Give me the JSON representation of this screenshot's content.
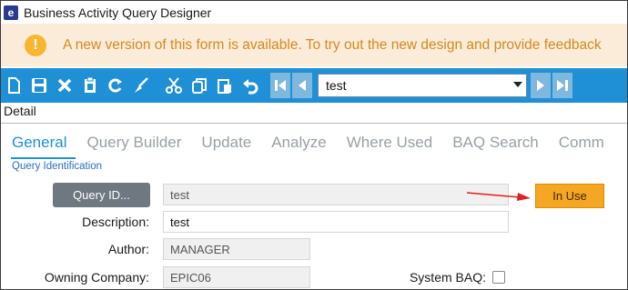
{
  "window": {
    "app_icon": "e",
    "title": "Business Activity Query Designer"
  },
  "banner": {
    "icon_text": "!",
    "message": "A new version of this form is available. To try out the new design and provide feedback"
  },
  "toolbar": {
    "icons": [
      "new-icon",
      "save-icon",
      "delete-icon",
      "clipboard-icon",
      "refresh-icon",
      "clear-icon",
      "cut-icon",
      "copy-icon",
      "paste-icon",
      "undo-icon"
    ],
    "nav_first": "first-record-icon",
    "nav_prev": "previous-record-icon",
    "nav_next": "next-record-icon",
    "nav_last": "last-record-icon",
    "selected_query": "test"
  },
  "panel": {
    "title": "Detail"
  },
  "tabs": [
    {
      "label": "General",
      "active": true
    },
    {
      "label": "Query Builder",
      "active": false
    },
    {
      "label": "Update",
      "active": false
    },
    {
      "label": "Analyze",
      "active": false
    },
    {
      "label": "Where Used",
      "active": false
    },
    {
      "label": "BAQ Search",
      "active": false
    },
    {
      "label": "Comm",
      "active": false
    }
  ],
  "form": {
    "group_title": "Query Identification",
    "query_id_button": "Query ID...",
    "query_id_value": "test",
    "description_label": "Description:",
    "description_value": "test",
    "author_label": "Author:",
    "author_value": "MANAGER",
    "owning_company_label": "Owning Company:",
    "owning_company_value": "EPIC06",
    "system_baq_label": "System BAQ:",
    "system_baq_checked": false,
    "in_use_button": "In Use"
  },
  "colors": {
    "toolbar": "#1f8fd6",
    "banner_bg": "#fbecd9",
    "banner_text": "#d78a21",
    "in_use": "#f5a623",
    "annotation_arrow": "#e02020"
  }
}
